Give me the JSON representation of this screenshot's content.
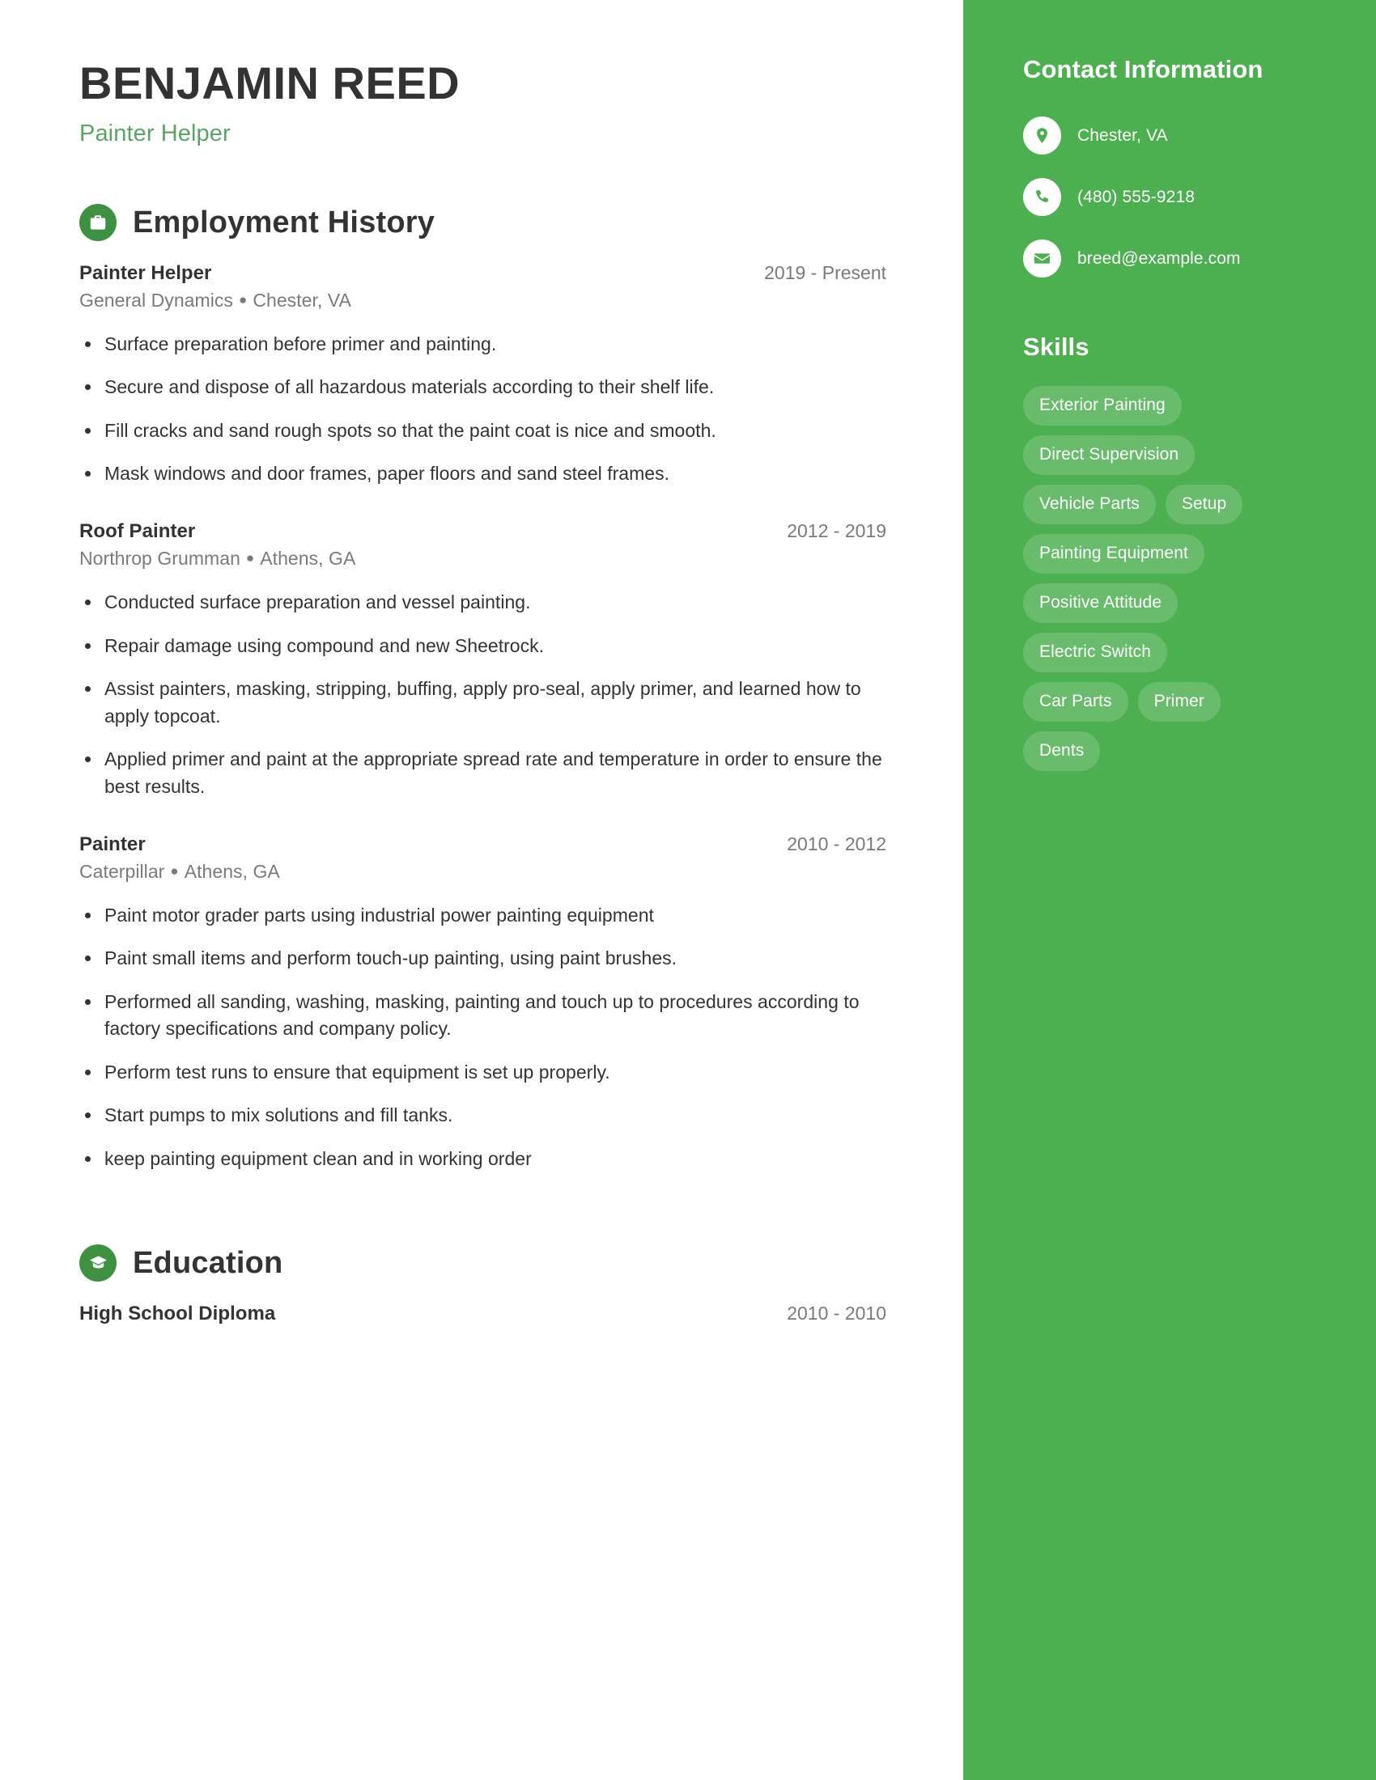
{
  "header": {
    "name": "BENJAMIN REED",
    "job_title": "Painter Helper"
  },
  "theme": {
    "sidebar_green": "#4CAF50",
    "icon_green": "#3D9140",
    "subtitle_green": "#5BA563",
    "text_dark": "#333333",
    "text_muted": "#7a7a7a"
  },
  "sections": {
    "employment": {
      "title": "Employment History",
      "icon": "briefcase-icon",
      "entries": [
        {
          "role": "Painter Helper",
          "date": "2019 - Present",
          "company": "General Dynamics",
          "location": "Chester, VA",
          "bullets": [
            "Surface preparation before primer and painting.",
            "Secure and dispose of all hazardous materials according to their shelf life.",
            "Fill cracks and sand rough spots so that the paint coat is nice and smooth.",
            "Mask windows and door frames, paper floors and sand steel frames."
          ]
        },
        {
          "role": "Roof Painter",
          "date": "2012 - 2019",
          "company": "Northrop Grumman",
          "location": "Athens, GA",
          "bullets": [
            "Conducted surface preparation and vessel painting.",
            "Repair damage using compound and new Sheetrock.",
            "Assist painters, masking, stripping, buffing, apply pro-seal, apply primer, and learned how to apply topcoat.",
            "Applied primer and paint at the appropriate spread rate and temperature in order to ensure the best results."
          ]
        },
        {
          "role": "Painter",
          "date": "2010 - 2012",
          "company": "Caterpillar",
          "location": "Athens, GA",
          "bullets": [
            "Paint motor grader parts using industrial power painting equipment",
            "Paint small items and perform touch-up painting, using paint brushes.",
            "Performed all sanding, washing, masking, painting and touch up to procedures according to factory specifications and company policy.",
            "Perform test runs to ensure that equipment is set up properly.",
            "Start pumps to mix solutions and fill tanks.",
            "keep painting equipment clean and in working order"
          ]
        }
      ]
    },
    "education": {
      "title": "Education",
      "icon": "graduation-cap-icon",
      "entries": [
        {
          "role": "High School Diploma",
          "date": "2010 - 2010"
        }
      ]
    }
  },
  "sidebar": {
    "contact": {
      "title": "Contact Information",
      "items": [
        {
          "icon": "location-pin-icon",
          "text": "Chester, VA"
        },
        {
          "icon": "phone-icon",
          "text": "(480) 555-9218"
        },
        {
          "icon": "envelope-icon",
          "text": "breed@example.com"
        }
      ]
    },
    "skills": {
      "title": "Skills",
      "items": [
        "Exterior Painting",
        "Direct Supervision",
        "Vehicle Parts",
        "Setup",
        "Painting Equipment",
        "Positive Attitude",
        "Electric Switch",
        "Car Parts",
        "Primer",
        "Dents"
      ]
    }
  }
}
